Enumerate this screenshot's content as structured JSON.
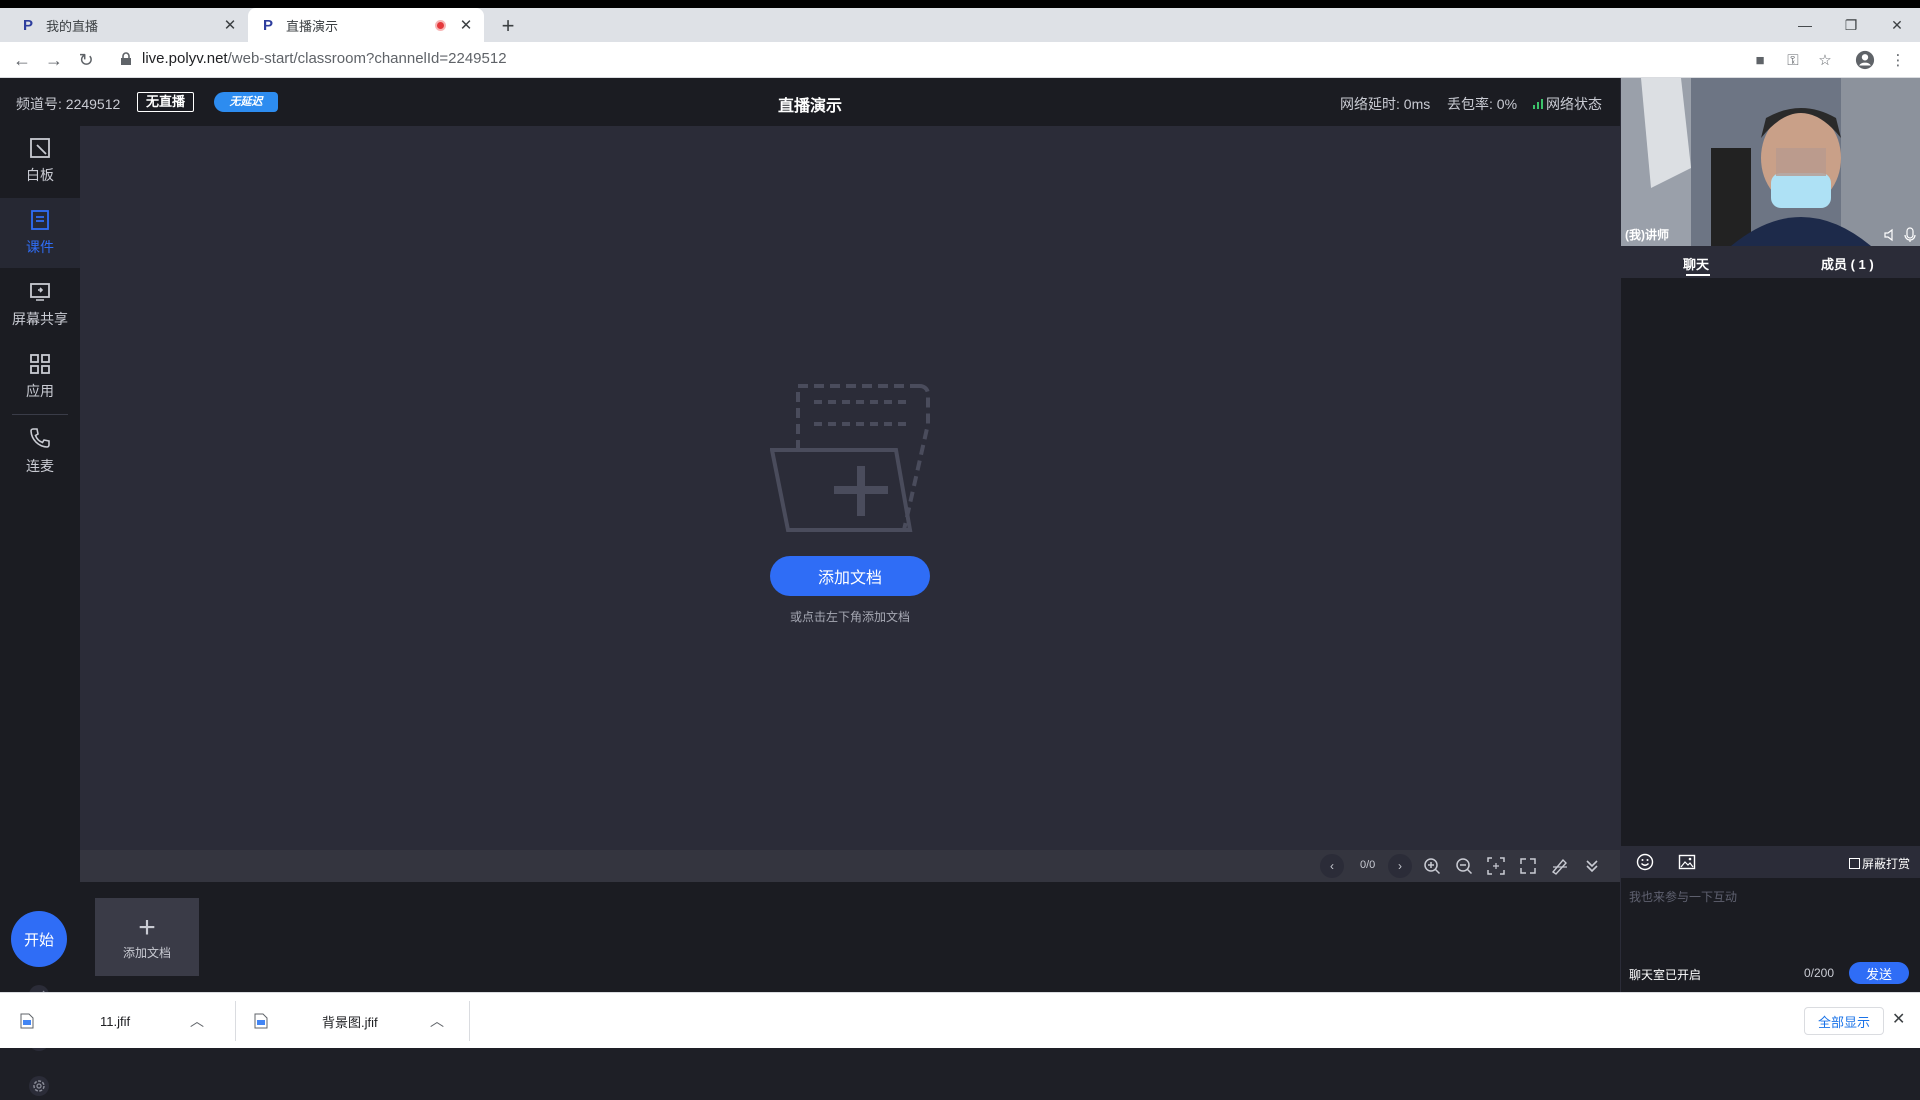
{
  "browser": {
    "tabs": [
      {
        "title": "我的直播",
        "active": false
      },
      {
        "title": "直播演示",
        "active": true
      }
    ],
    "url_host": "live.polyv.net",
    "url_path": "/web-start/classroom?channelId=2249512"
  },
  "header": {
    "channel": "频道号: 2249512",
    "live_badge": "无直播",
    "nolag_badge": "无延迟",
    "title": "直播演示",
    "latency": "网络延时: 0ms",
    "packet_loss": "丢包率: 0%",
    "network_status": "网络状态"
  },
  "sidebar": {
    "items": [
      {
        "label": "白板",
        "icon": "whiteboard-icon"
      },
      {
        "label": "课件",
        "icon": "courseware-icon",
        "active": true
      },
      {
        "label": "屏幕共享",
        "icon": "screen-share-icon"
      },
      {
        "label": "应用",
        "icon": "apps-grid-icon"
      },
      {
        "label": "连麦",
        "icon": "phone-icon"
      }
    ],
    "start_label": "开始"
  },
  "stage": {
    "add_doc_label": "添加文档",
    "hint": "或点击左下角添加文档"
  },
  "toolbar": {
    "page_count": "0/0"
  },
  "thumbs": {
    "add_label": "添加文档"
  },
  "right": {
    "video_label": "(我)讲师",
    "tab_chat": "聊天",
    "tab_members": "成员 ( 1 )",
    "block_reward": "屏蔽打赏",
    "input_placeholder": "我也来参与一下互动",
    "chat_status": "聊天室已开启",
    "char_count": "0/200",
    "send_label": "发送"
  },
  "downloads": {
    "items": [
      "11.jfif",
      "背景图.jfif"
    ],
    "show_all": "全部显示"
  },
  "colors": {
    "accent": "#2f6df6",
    "panel_dark": "#1b1c22",
    "stage_bg": "#2b2c38"
  }
}
